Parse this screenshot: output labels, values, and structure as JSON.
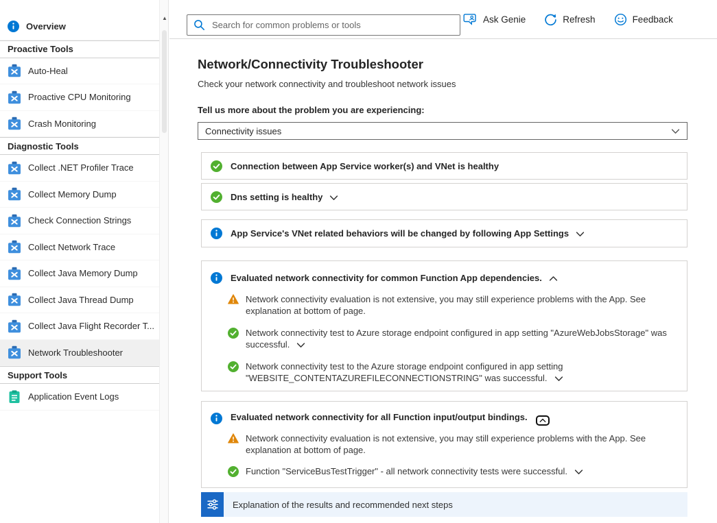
{
  "colors": {
    "accent_blue": "#0078d4",
    "success_green": "#52b030",
    "warning_orange": "#e0870a",
    "info_blue": "#0078d4",
    "footer_bar_bg": "#edf4fc",
    "footer_icon_bg": "#1a68c5",
    "selected_item_bg": "#f0f0f0"
  },
  "sidebar": {
    "items": [
      {
        "label": "Overview",
        "type": "item",
        "icon": "info"
      },
      {
        "label": "Proactive Tools",
        "type": "section"
      },
      {
        "label": "Auto-Heal",
        "type": "item",
        "icon": "toolbox"
      },
      {
        "label": "Proactive CPU Monitoring",
        "type": "item",
        "icon": "toolbox"
      },
      {
        "label": "Crash Monitoring",
        "type": "item",
        "icon": "toolbox"
      },
      {
        "label": "Diagnostic Tools",
        "type": "section"
      },
      {
        "label": "Collect .NET Profiler Trace",
        "type": "item",
        "icon": "toolbox"
      },
      {
        "label": "Collect Memory Dump",
        "type": "item",
        "icon": "toolbox"
      },
      {
        "label": "Check Connection Strings",
        "type": "item",
        "icon": "toolbox"
      },
      {
        "label": "Collect Network Trace",
        "type": "item",
        "icon": "toolbox"
      },
      {
        "label": "Collect Java Memory Dump",
        "type": "item",
        "icon": "toolbox"
      },
      {
        "label": "Collect Java Thread Dump",
        "type": "item",
        "icon": "toolbox"
      },
      {
        "label": "Collect Java Flight Recorder T...",
        "type": "item",
        "icon": "toolbox"
      },
      {
        "label": "Network Troubleshooter",
        "type": "item",
        "icon": "toolbox",
        "selected": true
      },
      {
        "label": "Support Tools",
        "type": "section"
      },
      {
        "label": "Application Event Logs",
        "type": "item",
        "icon": "event-logs"
      }
    ]
  },
  "toolbar": {
    "search_placeholder": "Search for common problems or tools",
    "ask_genie_label": "Ask Genie",
    "refresh_label": "Refresh",
    "feedback_label": "Feedback"
  },
  "main": {
    "title": "Network/Connectivity Troubleshooter",
    "subtitle": "Check your network connectivity and troubleshoot network issues",
    "question_label": "Tell us more about the problem you are experiencing:",
    "problem_dropdown": {
      "value": "Connectivity issues"
    },
    "results": [
      {
        "status": "success",
        "text": "Connection between App Service worker(s) and VNet is healthy",
        "expandable": false
      },
      {
        "status": "success",
        "text": "Dns setting is healthy",
        "expandable": true,
        "expanded": false
      },
      {
        "status": "info",
        "text": "App Service's VNet related behaviors will be changed by following App Settings",
        "expandable": true,
        "expanded": false
      },
      {
        "status": "info",
        "text": "Evaluated network connectivity for common Function App dependencies.",
        "expandable": true,
        "expanded": true,
        "children": [
          {
            "status": "warning",
            "text": "Network connectivity evaluation is not extensive, you may still experience problems with the App. See explanation at bottom of page.",
            "expandable": false
          },
          {
            "status": "success",
            "text": "Network connectivity test to Azure storage endpoint configured in app setting \"AzureWebJobsStorage\" was successful.",
            "expandable": true
          },
          {
            "status": "success",
            "text": "Network connectivity test to the Azure storage endpoint configured in app setting \"WEBSITE_CONTENTAZUREFILECONNECTIONSTRING\" was successful.",
            "expandable": true
          }
        ]
      },
      {
        "status": "info",
        "text": "Evaluated network connectivity for all Function input/output bindings.",
        "expandable": true,
        "expanded": true,
        "children": [
          {
            "status": "warning",
            "text": "Network connectivity evaluation is not extensive, you may still experience problems with the App. See explanation at bottom of page.",
            "expandable": false
          },
          {
            "status": "success",
            "text": "Function \"ServiceBusTestTrigger\" - all network connectivity tests were successful.",
            "expandable": true
          }
        ]
      }
    ],
    "footer": {
      "text": "Explanation of the results and recommended next steps"
    }
  }
}
